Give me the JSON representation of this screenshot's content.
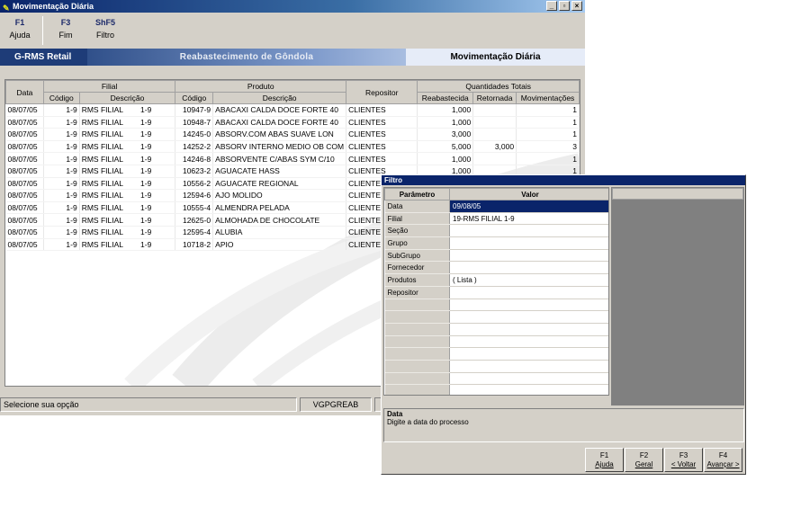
{
  "window": {
    "title": "Movimentação Diária",
    "controls": [
      "_",
      "▫",
      "×"
    ]
  },
  "fkeys": [
    {
      "key": "F1",
      "label": "Ajuda"
    },
    {
      "key": "F3",
      "label": "Fim"
    },
    {
      "key": "ShF5",
      "label": "Filtro"
    }
  ],
  "banner": {
    "brand": "G-RMS Retail",
    "module": "Reabastecimento de Gôndola",
    "screen": "Movimentação Diária"
  },
  "grid": {
    "group_headers": {
      "data": "Data",
      "filial": "Filial",
      "produto": "Produto",
      "repositor": "Repositor",
      "quantidades": "Quantidades Totais"
    },
    "sub_headers": {
      "filial_codigo": "Código",
      "filial_descricao": "Descrição",
      "produto_codigo": "Código",
      "produto_descricao": "Descrição",
      "reabastecida": "Reabastecida",
      "retornada": "Retornada",
      "movimentacoes": "Movimentações"
    },
    "rows": [
      {
        "data": "08/07/05",
        "fcod": "1-9",
        "fdesc": "RMS FILIAL",
        "fdesc2": "1-9",
        "pcod": "10947-9",
        "pdesc": "ABACAXI CALDA DOCE FORTE 40",
        "rep": "CLIENTES",
        "reab": "1,000",
        "ret": "",
        "mov": "1"
      },
      {
        "data": "08/07/05",
        "fcod": "1-9",
        "fdesc": "RMS FILIAL",
        "fdesc2": "1-9",
        "pcod": "10948-7",
        "pdesc": "ABACAXI CALDA DOCE FORTE 40",
        "rep": "CLIENTES",
        "reab": "1,000",
        "ret": "",
        "mov": "1"
      },
      {
        "data": "08/07/05",
        "fcod": "1-9",
        "fdesc": "RMS FILIAL",
        "fdesc2": "1-9",
        "pcod": "14245-0",
        "pdesc": "ABSORV.COM ABAS SUAVE LON",
        "rep": "CLIENTES",
        "reab": "3,000",
        "ret": "",
        "mov": "1"
      },
      {
        "data": "08/07/05",
        "fcod": "1-9",
        "fdesc": "RMS FILIAL",
        "fdesc2": "1-9",
        "pcod": "14252-2",
        "pdesc": "ABSORV INTERNO MEDIO OB COM",
        "rep": "CLIENTES",
        "reab": "5,000",
        "ret": "3,000",
        "mov": "3"
      },
      {
        "data": "08/07/05",
        "fcod": "1-9",
        "fdesc": "RMS FILIAL",
        "fdesc2": "1-9",
        "pcod": "14246-8",
        "pdesc": "ABSORVENTE C/ABAS SYM C/10",
        "rep": "CLIENTES",
        "reab": "1,000",
        "ret": "",
        "mov": "1"
      },
      {
        "data": "08/07/05",
        "fcod": "1-9",
        "fdesc": "RMS FILIAL",
        "fdesc2": "1-9",
        "pcod": "10623-2",
        "pdesc": "AGUACATE HASS",
        "rep": "CLIENTES",
        "reab": "1,000",
        "ret": "",
        "mov": "1"
      },
      {
        "data": "08/07/05",
        "fcod": "1-9",
        "fdesc": "RMS FILIAL",
        "fdesc2": "1-9",
        "pcod": "10556-2",
        "pdesc": "AGUACATE REGIONAL",
        "rep": "CLIENTES",
        "reab": "",
        "ret": "",
        "mov": ""
      },
      {
        "data": "08/07/05",
        "fcod": "1-9",
        "fdesc": "RMS FILIAL",
        "fdesc2": "1-9",
        "pcod": "12594-6",
        "pdesc": "AJO MOLIDO",
        "rep": "CLIENTES",
        "reab": "",
        "ret": "",
        "mov": ""
      },
      {
        "data": "08/07/05",
        "fcod": "1-9",
        "fdesc": "RMS FILIAL",
        "fdesc2": "1-9",
        "pcod": "10555-4",
        "pdesc": "ALMENDRA PELADA",
        "rep": "CLIENTES",
        "reab": "",
        "ret": "",
        "mov": ""
      },
      {
        "data": "08/07/05",
        "fcod": "1-9",
        "fdesc": "RMS FILIAL",
        "fdesc2": "1-9",
        "pcod": "12625-0",
        "pdesc": "ALMOHADA DE CHOCOLATE",
        "rep": "CLIENTES",
        "reab": "",
        "ret": "",
        "mov": ""
      },
      {
        "data": "08/07/05",
        "fcod": "1-9",
        "fdesc": "RMS FILIAL",
        "fdesc2": "1-9",
        "pcod": "12595-4",
        "pdesc": "ALUBIA",
        "rep": "CLIENTES",
        "reab": "",
        "ret": "",
        "mov": ""
      },
      {
        "data": "08/07/05",
        "fcod": "1-9",
        "fdesc": "RMS FILIAL",
        "fdesc2": "1-9",
        "pcod": "10718-2",
        "pdesc": "APIO",
        "rep": "CLIENTES",
        "reab": "",
        "ret": "",
        "mov": ""
      }
    ]
  },
  "status": {
    "message": "Selecione sua opção",
    "program": "VGPGREAB"
  },
  "filter": {
    "title": "Filtro",
    "headers": {
      "param": "Parâmetro",
      "value": "Valor"
    },
    "params": [
      {
        "name": "Data",
        "value": "09/08/05"
      },
      {
        "name": "Filial",
        "value": "19-RMS FILIAL        1-9"
      },
      {
        "name": "Seção",
        "value": ""
      },
      {
        "name": "Grupo",
        "value": ""
      },
      {
        "name": "SubGrupo",
        "value": ""
      },
      {
        "name": "Fornecedor",
        "value": ""
      },
      {
        "name": "Produtos",
        "value": "( Lista )"
      },
      {
        "name": "Repositor",
        "value": ""
      },
      {
        "name": "",
        "value": ""
      },
      {
        "name": "",
        "value": ""
      },
      {
        "name": "",
        "value": ""
      },
      {
        "name": "",
        "value": ""
      },
      {
        "name": "",
        "value": ""
      },
      {
        "name": "",
        "value": ""
      },
      {
        "name": "",
        "value": ""
      },
      {
        "name": "",
        "value": ""
      }
    ],
    "help_title": "Data",
    "help_text": "Digite a data do processo",
    "buttons": [
      {
        "key": "F1",
        "label": "Ajuda"
      },
      {
        "key": "F2",
        "label": "Geral"
      },
      {
        "key": "F3",
        "label": "< Voltar"
      },
      {
        "key": "F4",
        "label": "Avançar >"
      }
    ]
  }
}
